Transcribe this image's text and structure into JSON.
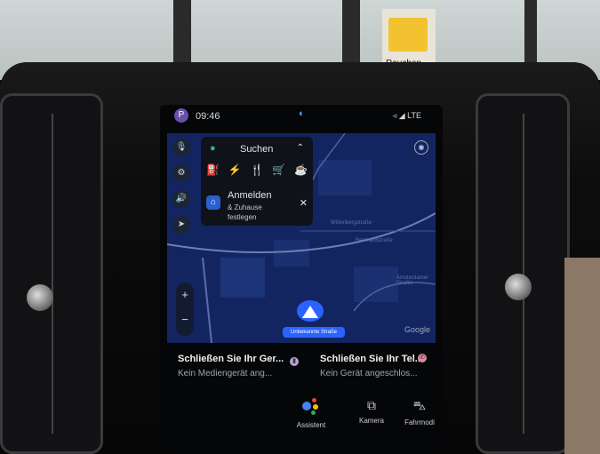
{
  "status_bar": {
    "avatar_letter": "P",
    "time": "09:46",
    "signal": "◃ ◢ LTE"
  },
  "sign": {
    "text": "Rauchen"
  },
  "map": {
    "search_label": "Suchen",
    "categories": [
      "⛽",
      "⚡",
      "🍴",
      "🛒",
      "☕"
    ],
    "signin": {
      "title": "Anmelden",
      "subtitle": "& Zuhause festlegen",
      "close": "✕"
    },
    "zoom_in": "+",
    "zoom_out": "−",
    "location_badge": "Unbekannte Straße",
    "attribution": "Google",
    "street_labels": [
      "Wittenbergstraße",
      "Bernhardstraße",
      "Amsterdamer Straße"
    ],
    "rail_icons": [
      "mic-icon",
      "settings-icon",
      "volume-icon",
      "compass-icon"
    ],
    "colors": {
      "water": "#12235a",
      "accent": "#2a63ff"
    }
  },
  "media": [
    {
      "title": "Schließen Sie Ihr Ger...",
      "subtitle": "Kein Mediengerät ang..."
    },
    {
      "title": "Schließen Sie Ihr Tel...",
      "subtitle": "Kein Gerät angeschlos..."
    }
  ],
  "dock": {
    "assistant": "Assistent",
    "camera": "Kamera",
    "drive": "Fahrmodi"
  }
}
